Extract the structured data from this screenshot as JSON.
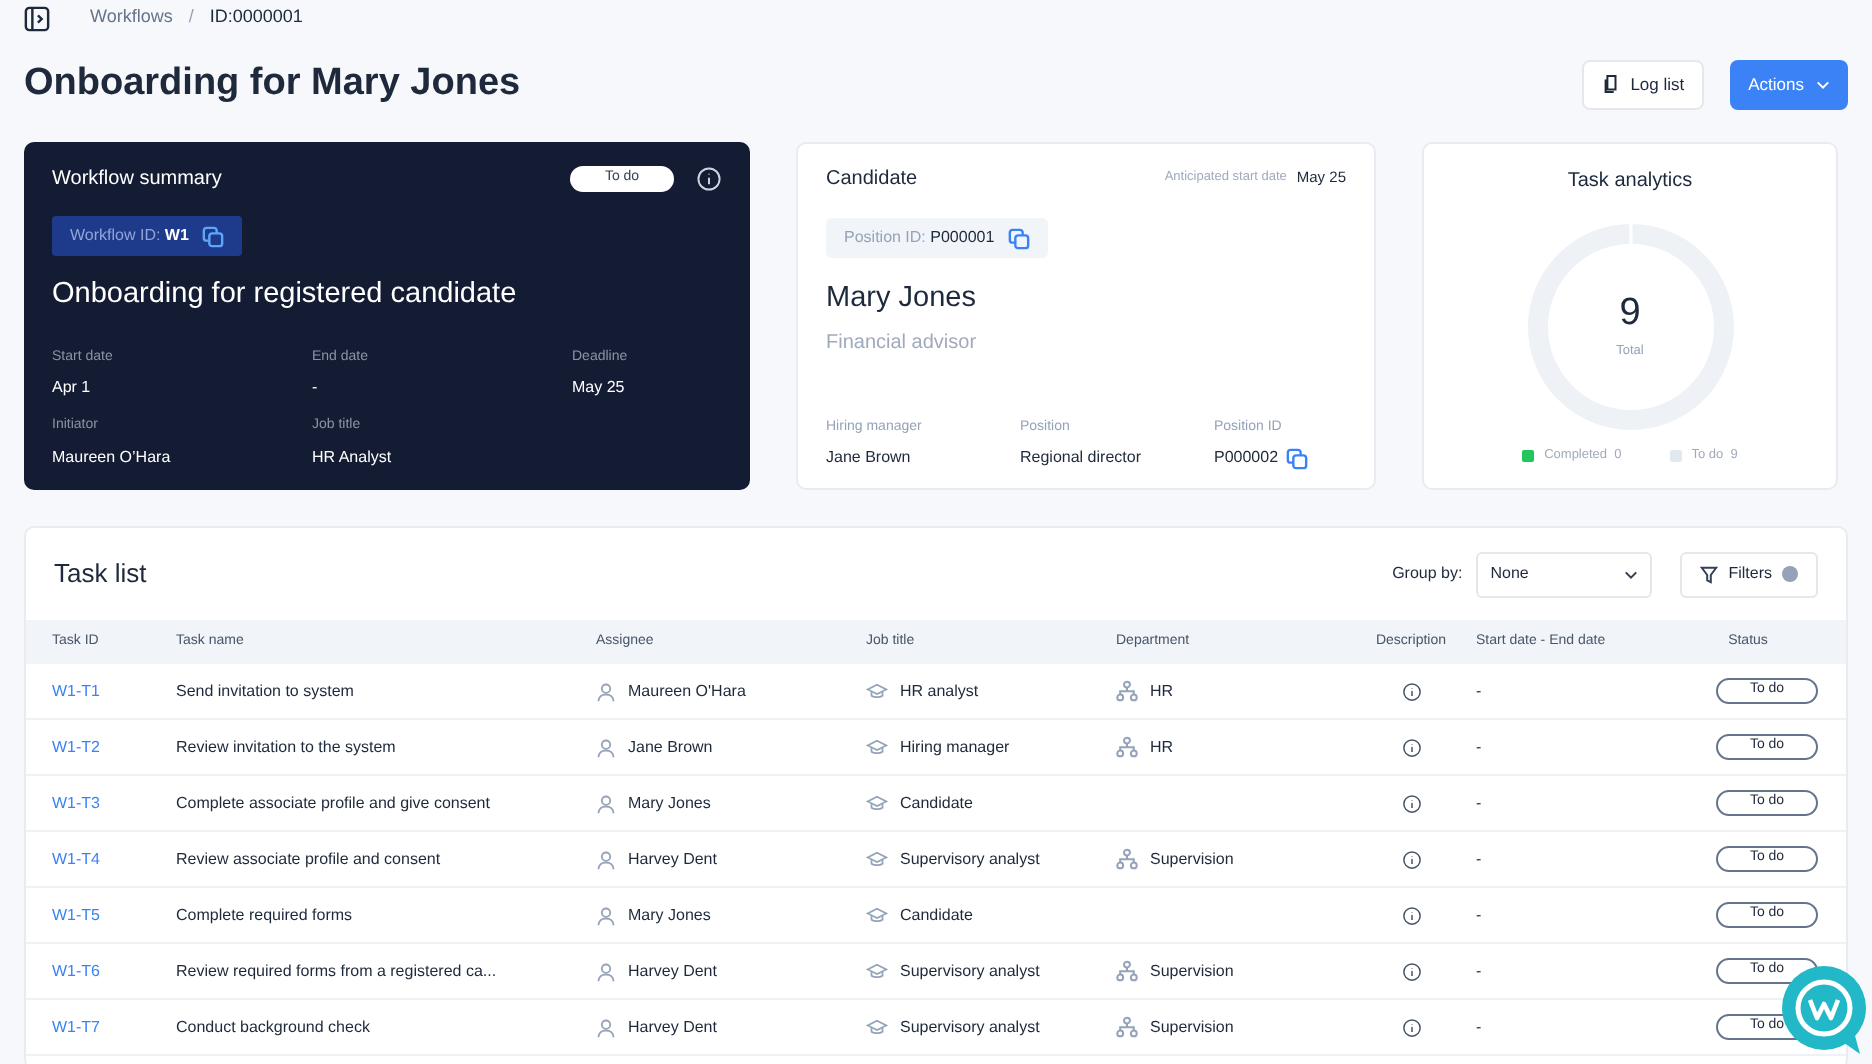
{
  "breadcrumb": {
    "items": [
      "Workflows",
      "ID:0000001"
    ],
    "separator": "/"
  },
  "title": "Onboarding for Mary Jones",
  "header_buttons": [
    {
      "kind": "outline",
      "label": "Log list"
    },
    {
      "kind": "primary",
      "label": "Actions"
    }
  ],
  "workflow_summary": {
    "title": "Workflow summary",
    "status": "To do",
    "id_label": "Workflow ID:",
    "id_value": "W1",
    "name": "Onboarding for registered candidate",
    "fields": [
      {
        "label": "Start date",
        "value": "Apr 1"
      },
      {
        "label": "End date",
        "value": "-"
      },
      {
        "label": "Deadline",
        "value": "May 25"
      },
      {
        "label": "Initiator",
        "value": "Maureen O’Hara"
      },
      {
        "label": "Job title",
        "value": "HR Analyst"
      }
    ]
  },
  "candidate": {
    "title": "Candidate",
    "start_label": "Anticipated start date",
    "start_value": "May 25",
    "position_id_label": "Position ID:",
    "position_id_value": "P000001",
    "name": "Mary Jones",
    "role": "Financial advisor",
    "fields": [
      {
        "label": "Hiring manager",
        "value": "Jane Brown",
        "kind": "plain"
      },
      {
        "label": "Position",
        "value": "Regional director",
        "kind": "plain"
      },
      {
        "label": "Position ID",
        "value": "P000002",
        "kind": "copyable"
      }
    ]
  },
  "task_analytics": {
    "title": "Task analytics",
    "total": "9",
    "total_label": "Total",
    "legend": [
      {
        "label": "Completed",
        "count": "0",
        "color": "#22c55e"
      },
      {
        "label": "To do",
        "count": "9",
        "color": "#e2e8f0"
      }
    ]
  },
  "task_list": {
    "title": "Task list",
    "group_by_label": "Group by:",
    "group_by_value": "None",
    "filters_label": "Filters",
    "columns": [
      "Task ID",
      "Task name",
      "Assignee",
      "Job title",
      "Department",
      "Description",
      "Start date - End date",
      "Status"
    ],
    "rows": [
      {
        "id": "W1-T1",
        "name": "Send invitation to system",
        "assignee": "Maureen O'Hara",
        "job": "HR analyst",
        "department": "HR",
        "dates": "-",
        "status": "To do"
      },
      {
        "id": "W1-T2",
        "name": "Review invitation to the system",
        "assignee": "Jane Brown",
        "job": "Hiring manager",
        "department": "HR",
        "dates": "-",
        "status": "To do"
      },
      {
        "id": "W1-T3",
        "name": "Complete associate profile and give consent",
        "assignee": "Mary Jones",
        "job": "Candidate",
        "dates": "-",
        "status": "To do"
      },
      {
        "id": "W1-T4",
        "name": "Review associate profile and consent",
        "assignee": "Harvey Dent",
        "job": "Supervisory analyst",
        "department": "Supervision",
        "dates": "-",
        "status": "To do"
      },
      {
        "id": "W1-T5",
        "name": "Complete required forms",
        "assignee": "Mary Jones",
        "job": "Candidate",
        "dates": "-",
        "status": "To do"
      },
      {
        "id": "W1-T6",
        "name": "Review required forms from a registered ca...",
        "assignee": "Harvey Dent",
        "job": "Supervisory analyst",
        "department": "Supervision",
        "dates": "-",
        "status": "To do"
      },
      {
        "id": "W1-T7",
        "name": "Conduct background check",
        "assignee": "Harvey Dent",
        "job": "Supervisory analyst",
        "department": "Supervision",
        "dates": "-",
        "status": "To do"
      }
    ]
  }
}
